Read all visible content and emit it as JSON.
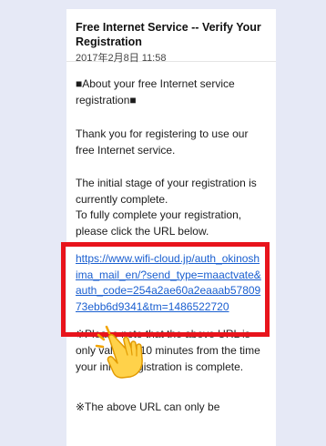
{
  "email": {
    "subject": "Free Internet Service -- Verify Your Registration",
    "date": "2017年2月8日 11:58",
    "paragraphs": {
      "about": "■About your free Internet service registration■",
      "thanks": "Thank you for registering to use our free Internet service.",
      "initial": "The initial stage of your registration is currently complete.",
      "instruction": "To fully complete your registration, please click the URL below.",
      "validity": "※Please note that the above URL is only valid for 10 minutes from the time your initial registration is complete.",
      "only_once": "※The above URL can only be"
    },
    "link": {
      "url": "https://www.wifi-cloud.jp/auth_okinoshima_mail_en/?send_type=maactvate&auth_code=254a2ae60a2eaaab5780973ebb6d9341&tm=1486522720"
    }
  },
  "highlight_color": "#e8141c",
  "link_color": "#1a5fd0",
  "icons": {
    "pointer": "pointing-hand-icon"
  }
}
